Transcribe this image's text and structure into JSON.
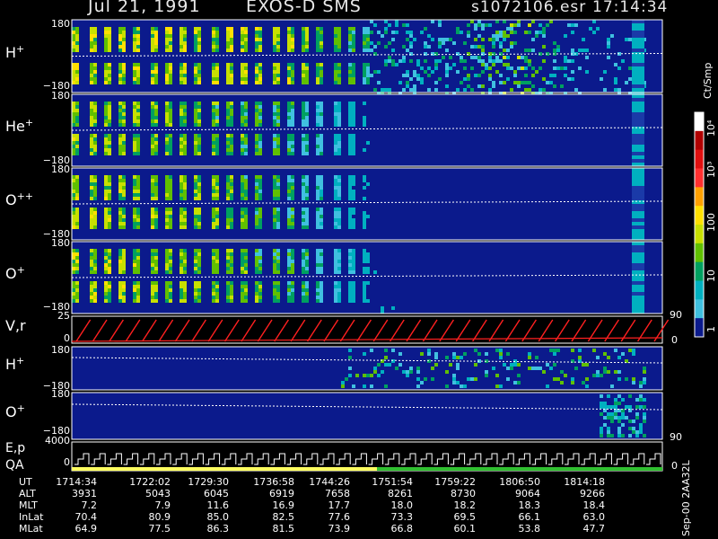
{
  "header": {
    "date": "Jul 21, 1991",
    "instrument": "EXOS-D SMS",
    "file": "s1072106.esr",
    "time": "17:14:34"
  },
  "panels": [
    {
      "label_main": "H",
      "label_sup": "+",
      "ymax": "180",
      "ymin": "−180"
    },
    {
      "label_main": "He",
      "label_sup": "+",
      "ymax": "180",
      "ymin": "−180"
    },
    {
      "label_main": "O",
      "label_sup": "++",
      "ymax": "180",
      "ymin": "−180"
    },
    {
      "label_main": "O",
      "label_sup": "+",
      "ymax": "180",
      "ymin": "−180"
    }
  ],
  "vr_panel": {
    "label": "V,r",
    "ymax": "25",
    "ymin": "0",
    "right_top": "90",
    "right_bottom": "0"
  },
  "h_panel2": {
    "label_main": "H",
    "label_sup": "+",
    "ymax": "180",
    "ymin": "−180"
  },
  "o_panel2": {
    "label_main": "O",
    "label_sup": "+",
    "ymax": "180",
    "ymin": "−180",
    "right_bottom": "90"
  },
  "ep_panel": {
    "label_top": "E,p",
    "label_bottom": "QA",
    "ymax": "4000",
    "ymin": "0",
    "right_bottom": "0"
  },
  "colorbar": {
    "unit": "Ct/Smp",
    "ticks": [
      "10⁴",
      "10³",
      "100",
      "10",
      "1"
    ],
    "colors": [
      "#ffffff",
      "#b00000",
      "#e01010",
      "#ff3030",
      "#ffa000",
      "#ffe000",
      "#c8e000",
      "#60c000",
      "#00a060",
      "#00b0c0",
      "#40c0e0",
      "#0b1a8c"
    ]
  },
  "side_note": "Sep-00 2AA32L",
  "ephemeris": {
    "rows": [
      {
        "name": "UT",
        "values": [
          "1714:34",
          "1722:02",
          "1729:30",
          "1736:58",
          "1744:26",
          "1751:54",
          "1759:22",
          "1806:50",
          "1814:18"
        ]
      },
      {
        "name": "ALT",
        "values": [
          "3931",
          "5043",
          "6045",
          "6919",
          "7658",
          "8261",
          "8730",
          "9064",
          "9266"
        ]
      },
      {
        "name": "MLT",
        "values": [
          "7.2",
          "7.9",
          "11.6",
          "16.9",
          "17.7",
          "18.0",
          "18.2",
          "18.3",
          "18.4"
        ]
      },
      {
        "name": "InLat",
        "values": [
          "70.4",
          "80.9",
          "85.0",
          "82.5",
          "77.6",
          "73.3",
          "69.5",
          "66.1",
          "63.0"
        ]
      },
      {
        "name": "MLat",
        "values": [
          "64.9",
          "77.5",
          "86.3",
          "81.5",
          "73.9",
          "66.8",
          "60.1",
          "53.8",
          "47.7"
        ]
      }
    ]
  },
  "chart_data": {
    "type": "heatmap",
    "x_ticks": [
      "1714:34",
      "1722:02",
      "1729:30",
      "1736:58",
      "1744:26",
      "1751:54",
      "1759:22",
      "1806:50",
      "1814:18"
    ],
    "species": [
      "H+",
      "He+",
      "O++",
      "O+"
    ],
    "ylim": [
      -180,
      180
    ],
    "color_scale": "log",
    "clim": [
      1,
      10000
    ],
    "activity": {
      "H+": [
        0.9,
        0.85,
        0.85,
        0.8,
        0.55,
        0.5,
        0.85,
        0.3,
        0.6
      ],
      "He+": [
        0.8,
        0.75,
        0.7,
        0.55,
        0.15,
        0.1,
        0.05,
        0.05,
        0.1
      ],
      "O++": [
        0.85,
        0.8,
        0.75,
        0.55,
        0.15,
        0.1,
        0.05,
        0.05,
        0.1
      ],
      "O+": [
        0.85,
        0.8,
        0.75,
        0.6,
        0.2,
        0.1,
        0.05,
        0.05,
        0.2
      ]
    }
  }
}
